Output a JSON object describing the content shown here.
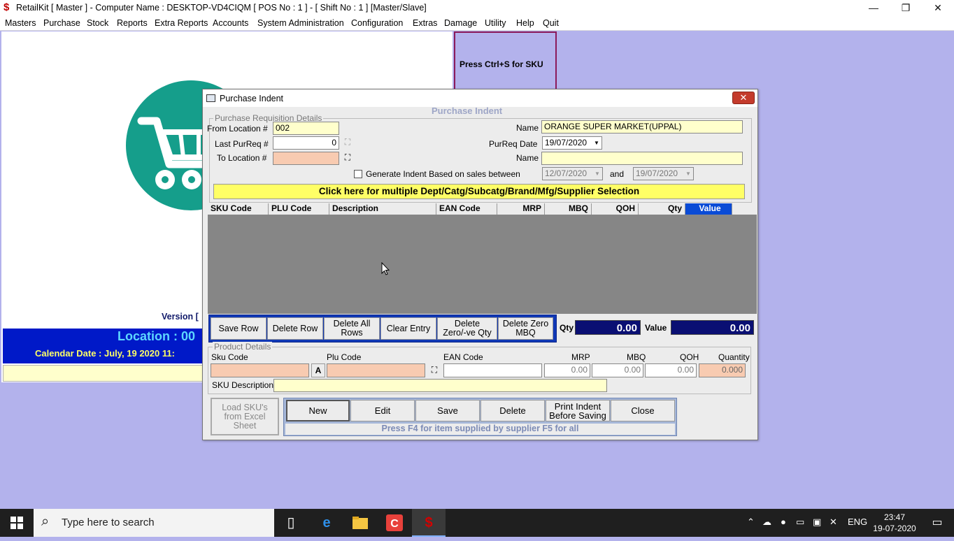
{
  "window": {
    "title": "RetailKit [ Master ] - Computer Name : DESKTOP-VD4CIQM [ POS No : 1 ] - [ Shift No : 1 ]  [Master/Slave]",
    "app_icon": "$",
    "minimize": "—",
    "restore": "❐",
    "close": "✕"
  },
  "menu": [
    "Masters",
    "Purchase",
    "Stock",
    "Reports",
    "Extra Reports",
    "Accounts",
    "System Administration",
    "Configuration",
    "Extras",
    "Damage",
    "Utility",
    "Help",
    "Quit"
  ],
  "background": {
    "sku_hint": "Press Ctrl+S for SKU",
    "version": "Version [",
    "location": "Location : 00",
    "calendar": "Calendar Date : July, 19 2020 11:"
  },
  "dialog": {
    "title": "Purchase Indent",
    "close": "✕",
    "heading": "Purchase Indent",
    "group_label": "Purchase Requisition Details",
    "from_location_label": "From Location #",
    "from_location_value": "002",
    "last_purreq_label": "Last PurReq #",
    "last_purreq_value": "0",
    "to_location_label": "To Location #",
    "to_location_value": "",
    "name_label": "Name",
    "name_value": "ORANGE SUPER MARKET(UPPAL)",
    "purreq_date_label": "PurReq Date",
    "purreq_date_value": "19/07/2020",
    "name2_label": "Name",
    "name2_value": "",
    "generate_label": "Generate Indent Based on sales between",
    "sales_from": "12/07/2020",
    "and_label": "and",
    "sales_to": "19/07/2020",
    "selection_button": "Click here for multiple Dept/Catg/Subcatg/Brand/Mfg/Supplier Selection",
    "columns": [
      "SKU Code",
      "PLU Code",
      "Description",
      "EAN Code",
      "MRP",
      "MBQ",
      "QOH",
      "Qty",
      "Value"
    ],
    "buttons": {
      "save_row": "Save Row",
      "delete_row": "Delete Row",
      "delete_all_1": "Delete All",
      "delete_all_2": "Rows",
      "clear_entry": "Clear Entry",
      "delete_zero_1": "Delete",
      "delete_zero_2": "Zero/-ve Qty",
      "delete_mbq_1": "Delete Zero",
      "delete_mbq_2": "MBQ"
    },
    "qty_label": "Qty",
    "qty_total": "0.00",
    "value_label": "Value",
    "value_total": "0.00",
    "product_group_label": "Product Details",
    "product": {
      "sku_code_label": "Sku Code",
      "plu_code_label": "Plu Code",
      "ean_code_label": "EAN Code",
      "mrp_label": "MRP",
      "mbq_label": "MBQ",
      "qoh_label": "QOH",
      "quantity_label": "Quantity",
      "a_button": "A",
      "mrp_value": "0.00",
      "mbq_value": "0.00",
      "qoh_value": "0.00",
      "quantity_value": "0.000",
      "sku_desc_label": "SKU Description",
      "sku_desc_value": ""
    },
    "excel_1": "Load SKU's",
    "excel_2": "from Excel",
    "excel_3": "Sheet",
    "actions": {
      "new": "New",
      "edit": "Edit",
      "save": "Save",
      "delete": "Delete",
      "print_1": "Print Indent",
      "print_2": "Before Saving",
      "close": "Close"
    },
    "hint": "Press F4 for item supplied by supplier F5 for all"
  },
  "taskbar": {
    "search_placeholder": "Type here to search",
    "lang": "ENG",
    "time": "23:47",
    "date": "19-07-2020"
  },
  "colors": {
    "desktop_bg": "#b3b2ec",
    "location_bar": "#0019c8",
    "selection_yellow": "#ffff66",
    "total_navy": "#0a0f73",
    "peach_field": "#f8cbb1"
  }
}
